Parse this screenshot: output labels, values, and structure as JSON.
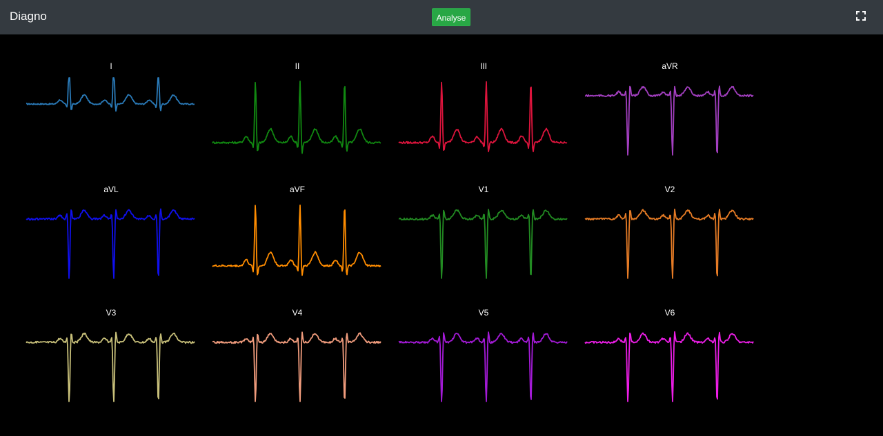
{
  "header": {
    "brand": "Diagno",
    "analyse_label": "Analyse",
    "fullscreen_icon": "fullscreen-icon",
    "bar_color": "#343a40",
    "button_color": "#28a745"
  },
  "leads": [
    {
      "id": "lead-i",
      "label": "I",
      "color": "#2a7ab8",
      "inverted": false,
      "tall": "small"
    },
    {
      "id": "lead-ii",
      "label": "II",
      "color": "#118811",
      "inverted": false,
      "tall": "large"
    },
    {
      "id": "lead-iii",
      "label": "III",
      "color": "#dc143c",
      "inverted": false,
      "tall": "large"
    },
    {
      "id": "lead-avr",
      "label": "aVR",
      "color": "#a33fc0",
      "inverted": true,
      "tall": "large"
    },
    {
      "id": "lead-avl",
      "label": "aVL",
      "color": "#1010ee",
      "inverted": true,
      "tall": "small"
    },
    {
      "id": "lead-avf",
      "label": "aVF",
      "color": "#ff8c00",
      "inverted": false,
      "tall": "large"
    },
    {
      "id": "lead-v1",
      "label": "V1",
      "color": "#228b22",
      "inverted": true,
      "tall": "large"
    },
    {
      "id": "lead-v2",
      "label": "V2",
      "color": "#e57b25",
      "inverted": true,
      "tall": "large"
    },
    {
      "id": "lead-v3",
      "label": "V3",
      "color": "#c8c07a",
      "inverted": true,
      "tall": "large"
    },
    {
      "id": "lead-v4",
      "label": "V4",
      "color": "#ef9b7c",
      "inverted": true,
      "tall": "large"
    },
    {
      "id": "lead-v5",
      "label": "V5",
      "color": "#a31ad6",
      "inverted": true,
      "tall": "large"
    },
    {
      "id": "lead-v6",
      "label": "V6",
      "color": "#ee1ee8",
      "inverted": true,
      "tall": "large"
    }
  ]
}
